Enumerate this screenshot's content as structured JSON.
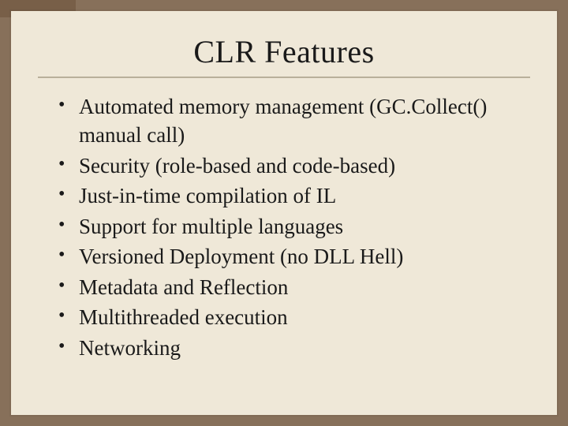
{
  "slide": {
    "title": "CLR Features",
    "bullets": [
      "Automated memory management (GC.Collect() manual call)",
      "Security (role-based and code-based)",
      "Just-in-time compilation of IL",
      "Support for multiple languages",
      "Versioned Deployment (no DLL Hell)",
      "Metadata and Reflection",
      "Multithreaded execution",
      "Networking"
    ]
  }
}
